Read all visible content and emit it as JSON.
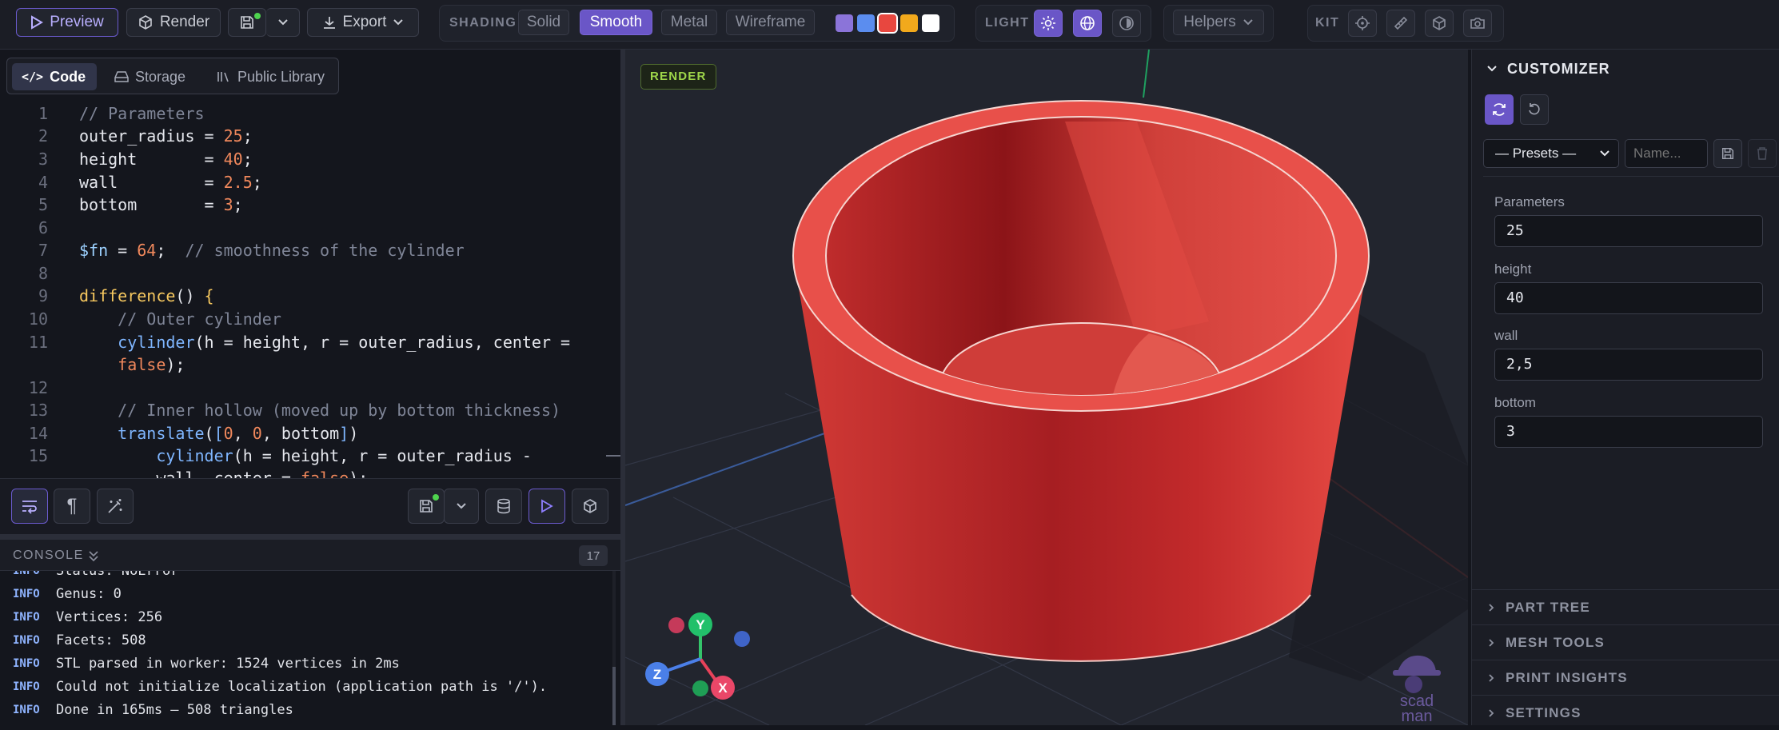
{
  "toolbar": {
    "preview": "Preview",
    "render": "Render",
    "export": "Export",
    "shading_label": "SHADING",
    "shading": [
      "Solid",
      "Smooth",
      "Metal",
      "Wireframe"
    ],
    "shading_active": "Smooth",
    "swatch_colors": [
      "#8b74d9",
      "#5b8def",
      "#e8473f",
      "#f2a91c",
      "#ffffff"
    ],
    "light_label": "LIGHT",
    "helpers": "Helpers",
    "kit_label": "KIT"
  },
  "tabs": [
    "Code",
    "Storage",
    "Public Library"
  ],
  "editor": {
    "line_numbers": [
      "1",
      "2",
      "3",
      "4",
      "5",
      "6",
      "7",
      "8",
      "9",
      "10",
      "11",
      "",
      "12",
      "13",
      "14",
      "15"
    ]
  },
  "console": {
    "title": "CONSOLE",
    "count": "17",
    "tag": "INFO",
    "lines": [
      "Status: NoError",
      "Genus: 0",
      "Vertices: 256",
      "Facets: 508",
      "STL parsed in worker: 1524 vertices in 2ms",
      "Could not initialize localization (application path is '/').",
      "Done in 165ms — 508 triangles"
    ]
  },
  "viewport": {
    "badge": "RENDER",
    "axes": {
      "x": "X",
      "y": "Y",
      "z": "Z"
    },
    "logo_line1": "scad",
    "logo_line2": "man"
  },
  "customizer": {
    "title": "CUSTOMIZER",
    "presets": "— Presets —",
    "name_placeholder": "Name...",
    "params": [
      {
        "label": "Parameters",
        "value": "25"
      },
      {
        "label": "height",
        "value": "40"
      },
      {
        "label": "wall",
        "value": "2,5"
      },
      {
        "label": "bottom",
        "value": "3"
      }
    ],
    "sections": [
      "PART TREE",
      "MESH TOOLS",
      "PRINT INSIGHTS",
      "SETTINGS"
    ]
  }
}
